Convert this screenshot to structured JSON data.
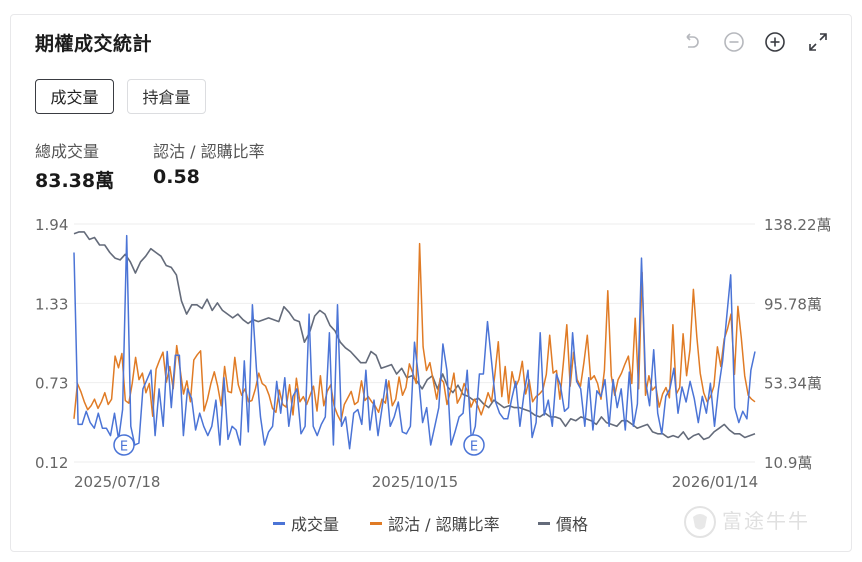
{
  "title": "期權成交統計",
  "toolbar": {
    "icons": [
      "undo-icon",
      "zoom-out-icon",
      "zoom-in-icon",
      "fullscreen-icon"
    ]
  },
  "tabs": [
    {
      "label": "成交量",
      "active": true
    },
    {
      "label": "持倉量",
      "active": false
    }
  ],
  "stats": {
    "total_volume_label": "總成交量",
    "total_volume_value": "83.38萬",
    "ratio_label": "認沽 / 認購比率",
    "ratio_value": "0.58"
  },
  "watermark": "富途牛牛",
  "colors": {
    "volume": "#4b74d6",
    "ratio": "#e07b25",
    "price": "#646b7a",
    "grid": "#eeeeee",
    "axis_text": "#666666"
  },
  "chart_data": {
    "type": "line",
    "x_tick_labels": [
      "2025/07/18",
      "2025/10/15",
      "2026/01/14"
    ],
    "left_axis": {
      "ticks": [
        "1.94",
        "1.33",
        "0.73",
        "0.12"
      ],
      "ylim": [
        0.12,
        1.94
      ]
    },
    "right_axis": {
      "ticks": [
        "138.22萬",
        "95.78萬",
        "53.34萬",
        "10.9萬"
      ],
      "ylim": [
        10.9,
        138.22
      ]
    },
    "markers": [
      "E",
      "E"
    ],
    "series": [
      {
        "name": "成交量",
        "axis": "right",
        "values": [
          123,
          31,
          31,
          38,
          32,
          29,
          37,
          29,
          29,
          25,
          37,
          23,
          39,
          132,
          30,
          20,
          21,
          50,
          55,
          60,
          25,
          50,
          30,
          70,
          40,
          68,
          68,
          25,
          50,
          45,
          28,
          37,
          30,
          25,
          30,
          44,
          20,
          56,
          23,
          30,
          28,
          20,
          65,
          27,
          95,
          61,
          35,
          20,
          27,
          30,
          54,
          37,
          56,
          30,
          46,
          50,
          26,
          30,
          90,
          30,
          25,
          31,
          35,
          80,
          20,
          95,
          30,
          35,
          18,
          37,
          39,
          31,
          60,
          28,
          44,
          25,
          40,
          55,
          30,
          35,
          43,
          27,
          26,
          30,
          75,
          56,
          32,
          40,
          20,
          30,
          40,
          74,
          60,
          20,
          27,
          35,
          37,
          60,
          23,
          30,
          58,
          58,
          86,
          65,
          43,
          37,
          34,
          34,
          45,
          54,
          30,
          47,
          60,
          24,
          32,
          80,
          36,
          44,
          30,
          58,
          52,
          38,
          40,
          80,
          54,
          50,
          30,
          56,
          28,
          49,
          46,
          55,
          30,
          55,
          40,
          50,
          28,
          59,
          30,
          42,
          120,
          54,
          41,
          71,
          37,
          26,
          46,
          50,
          61,
          37,
          51,
          43,
          54,
          45,
          32,
          46,
          37,
          53,
          30,
          50,
          65,
          88,
          111,
          40,
          32,
          38,
          34,
          60,
          70
        ]
      },
      {
        "name": "認沽 / 認購比率",
        "axis": "left",
        "values": [
          0.45,
          0.72,
          0.66,
          0.58,
          0.52,
          0.55,
          0.6,
          0.53,
          0.58,
          0.65,
          0.56,
          0.6,
          0.93,
          0.84,
          0.95,
          0.59,
          0.57,
          0.72,
          0.92,
          0.75,
          0.8,
          0.65,
          0.72,
          0.47,
          0.83,
          0.9,
          0.96,
          0.73,
          0.85,
          0.68,
          1.01,
          0.83,
          0.64,
          0.74,
          0.58,
          0.9,
          0.94,
          0.97,
          0.51,
          0.6,
          0.72,
          0.81,
          0.7,
          0.55,
          0.85,
          0.66,
          0.65,
          0.92,
          0.71,
          0.63,
          0.68,
          0.58,
          0.59,
          0.68,
          0.8,
          0.72,
          0.7,
          0.63,
          0.53,
          0.5,
          0.67,
          0.56,
          0.54,
          0.71,
          0.48,
          0.76,
          0.58,
          0.62,
          0.56,
          0.63,
          0.7,
          0.51,
          0.78,
          0.55,
          0.66,
          0.71,
          0.55,
          0.48,
          0.43,
          0.56,
          0.61,
          0.66,
          0.56,
          0.58,
          0.74,
          0.59,
          0.62,
          0.58,
          0.55,
          0.5,
          0.6,
          0.57,
          0.74,
          0.55,
          0.6,
          0.77,
          0.63,
          0.69,
          0.87,
          0.8,
          0.72,
          1.79,
          1.0,
          0.82,
          0.88,
          0.74,
          0.6,
          0.76,
          0.73,
          0.56,
          0.66,
          0.8,
          0.57,
          0.62,
          0.72,
          0.66,
          0.54,
          0.6,
          0.55,
          0.48,
          0.56,
          0.65,
          0.58,
          0.79,
          1.04,
          0.62,
          0.85,
          0.57,
          0.81,
          0.69,
          0.75,
          0.89,
          0.64,
          0.75,
          0.58,
          0.62,
          0.64,
          0.67,
          0.79,
          1.09,
          0.8,
          0.82,
          0.6,
          0.88,
          1.17,
          0.7,
          0.96,
          0.75,
          0.7,
          0.88,
          1.09,
          0.75,
          0.78,
          0.72,
          0.6,
          0.82,
          1.43,
          0.78,
          0.63,
          0.75,
          0.8,
          0.87,
          0.93,
          0.72,
          1.22,
          0.68,
          1.57,
          0.63,
          0.78,
          0.67,
          0.7,
          0.54,
          0.64,
          0.69,
          0.61,
          1.17,
          0.64,
          0.69,
          1.1,
          0.78,
          0.98,
          1.44,
          1.08,
          0.8,
          0.65,
          0.58,
          0.62,
          0.7,
          1.0,
          0.85,
          1.06,
          1.14,
          1.25,
          0.79,
          1.31,
          1.07,
          0.78,
          0.63,
          0.6,
          0.58
        ]
      },
      {
        "name": "價格",
        "axis": "right",
        "values": [
          133,
          134,
          134,
          130,
          131,
          127,
          127,
          123,
          120,
          119,
          122,
          118,
          112,
          118,
          121,
          125,
          123,
          121,
          116,
          115,
          111,
          97,
          90,
          95,
          95,
          93,
          98,
          92,
          96,
          92,
          90,
          88,
          90,
          87,
          85,
          87,
          86,
          87,
          88,
          87,
          86,
          94,
          91,
          87,
          86,
          75,
          80,
          89,
          92,
          90,
          84,
          81,
          75,
          72,
          70,
          67,
          64,
          64,
          70,
          68,
          61,
          62,
          63,
          58,
          61,
          56,
          57,
          54,
          50,
          55,
          57,
          50,
          58,
          51,
          48,
          52,
          47,
          46,
          44,
          45,
          42,
          40,
          44,
          42,
          40,
          41,
          40,
          40,
          39,
          38,
          36,
          35,
          37,
          35,
          35,
          34,
          30,
          34,
          33,
          35,
          34,
          33,
          31,
          35,
          32,
          31,
          30,
          33,
          33,
          31,
          29,
          30,
          31,
          27,
          26,
          26,
          24,
          25,
          24,
          27,
          23,
          25,
          26,
          23,
          24,
          27,
          29,
          31,
          28,
          26,
          26,
          24,
          25,
          26
        ]
      }
    ]
  }
}
